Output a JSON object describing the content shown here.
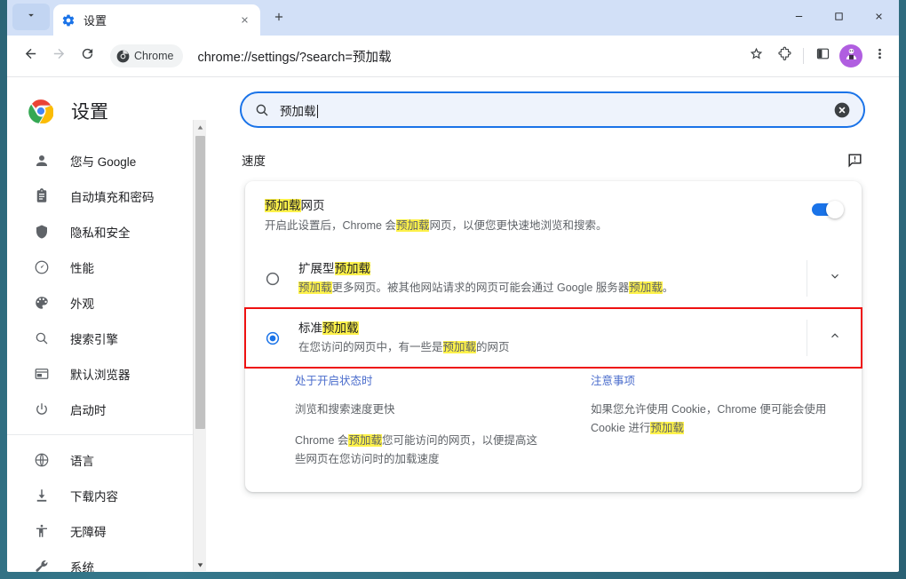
{
  "window": {
    "controls": {
      "minimize": "minimize-icon",
      "maximize": "maximize-icon",
      "close": "close-icon"
    }
  },
  "tabstrip": {
    "tab_search_icon": "chevron-down-icon",
    "tabs": [
      {
        "title": "设置",
        "favicon": "settings-gear-icon",
        "active": true
      }
    ],
    "close_icon": "close-icon",
    "new_tab_icon": "plus-icon"
  },
  "toolbar": {
    "back_icon": "arrow-back-icon",
    "forward_icon": "arrow-forward-icon",
    "reload_icon": "reload-icon",
    "chip_label": "Chrome",
    "chip_icon": "chrome-logo-icon",
    "url": "chrome://settings/?search=预加载",
    "bookmark_icon": "star-icon",
    "extensions_icon": "puzzle-piece-icon",
    "side_panel_icon": "side-panel-icon",
    "avatar_icon": "profile-avatar-icon",
    "menu_icon": "three-dot-menu-icon"
  },
  "sidebar": {
    "logo_icon": "chrome-logo-icon",
    "title": "设置",
    "groups": [
      {
        "items": [
          {
            "label": "您与 Google",
            "icon": "person-icon"
          },
          {
            "label": "自动填充和密码",
            "icon": "clipboard-icon"
          },
          {
            "label": "隐私和安全",
            "icon": "shield-icon"
          },
          {
            "label": "性能",
            "icon": "speedometer-icon"
          },
          {
            "label": "外观",
            "icon": "palette-icon"
          },
          {
            "label": "搜索引擎",
            "icon": "search-icon"
          },
          {
            "label": "默认浏览器",
            "icon": "browser-window-icon"
          },
          {
            "label": "启动时",
            "icon": "power-icon"
          }
        ]
      },
      {
        "items": [
          {
            "label": "语言",
            "icon": "globe-icon"
          },
          {
            "label": "下载内容",
            "icon": "download-icon"
          },
          {
            "label": "无障碍",
            "icon": "accessibility-icon"
          },
          {
            "label": "系统",
            "icon": "wrench-icon"
          }
        ]
      }
    ],
    "scrollbar": {
      "up_icon": "scroll-up-arrow-icon",
      "down_icon": "scroll-down-arrow-icon"
    }
  },
  "main": {
    "search": {
      "icon": "search-icon",
      "value": "预加载",
      "clear_icon": "clear-circle-icon"
    },
    "section": {
      "title": "速度",
      "feedback_icon": "feedback-icon"
    },
    "preload_card": {
      "title_pre": "预加载",
      "title_post": "网页",
      "desc_1": "开启此设置后，Chrome 会",
      "desc_hl": "预加载",
      "desc_2": "网页，以便您更快速地浏览和搜索。",
      "toggle_on": true,
      "options": [
        {
          "title_pre": "扩展型",
          "title_hl": "预加载",
          "title_post": "",
          "sub_hl1": "预加载",
          "sub_1": "更多网页。被其他网站请求的网页可能会通过 Google 服务器",
          "sub_hl2": "预加载",
          "sub_2": "。",
          "selected": false,
          "expander_icon": "chevron-down-icon",
          "highlighted_box": false
        },
        {
          "title_pre": "标准",
          "title_hl": "预加载",
          "title_post": "",
          "sub_pre": "在您访问的网页中，有一些是",
          "sub_hl1": "预加载",
          "sub_post": "的网页",
          "selected": true,
          "expander_icon": "chevron-up-icon",
          "highlighted_box": true
        }
      ],
      "details": {
        "left": {
          "heading": "处于开启状态时",
          "p1": "浏览和搜索速度更快",
          "p2_pre": "Chrome 会",
          "p2_hl": "预加载",
          "p2_post": "您可能访问的网页，以便提高这些网页在您访问时的加载速度"
        },
        "right": {
          "heading": "注意事项",
          "p1_pre": "如果您允许使用 Cookie，Chrome 便可能会使用 Cookie 进行",
          "p1_hl": "预加载"
        }
      }
    }
  },
  "colors": {
    "accent": "#1a73e8",
    "highlight": "#fdf14a",
    "red_outline": "#ee1111",
    "tabstrip_bg": "#d2e0f7",
    "avatar_bg": "#b05ee0"
  }
}
